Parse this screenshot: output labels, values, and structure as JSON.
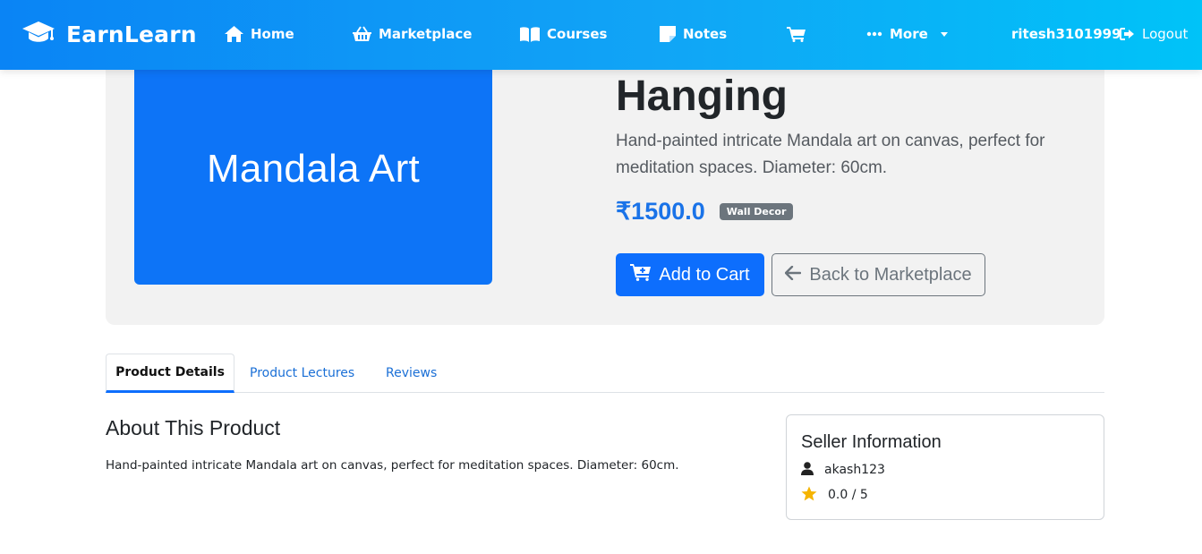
{
  "navbar": {
    "brand": "EarnLearn",
    "items": [
      {
        "label": "Home",
        "icon": "home-icon"
      },
      {
        "label": "Marketplace",
        "icon": "basket-icon"
      },
      {
        "label": "Courses",
        "icon": "book-icon"
      },
      {
        "label": "Notes",
        "icon": "note-icon"
      },
      {
        "label": "",
        "icon": "cart-icon"
      },
      {
        "label": "More",
        "icon": "ellipsis-icon"
      }
    ],
    "username": "ritesh3101999",
    "logout": "Logout"
  },
  "product": {
    "image_label": "Mandala Art",
    "title": "Hanging",
    "description": "Hand-painted intricate Mandala art on canvas, perfect for meditation spaces. Diameter: 60cm.",
    "price": "₹1500.0",
    "category": "Wall Decor",
    "add_to_cart": "Add to Cart",
    "back": "Back to Marketplace"
  },
  "tabs": [
    {
      "label": "Product Details",
      "active": true
    },
    {
      "label": "Product Lectures",
      "active": false
    },
    {
      "label": "Reviews",
      "active": false
    }
  ],
  "about": {
    "title": "About This Product",
    "text": "Hand-painted intricate Mandala art on canvas, perfect for meditation spaces. Diameter: 60cm."
  },
  "seller": {
    "title": "Seller Information",
    "name": "akash123",
    "rating": "0.0 / 5"
  },
  "colors": {
    "navbar_start": "#0a84f5",
    "navbar_end": "#00c3f8",
    "primary": "#0d6efd",
    "price": "#1a73e8",
    "star": "#f5b400"
  }
}
